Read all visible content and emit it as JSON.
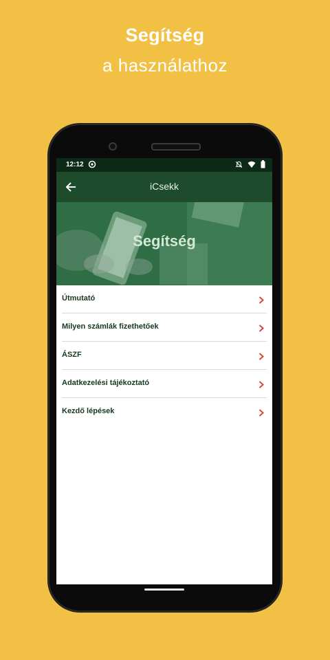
{
  "promo": {
    "title": "Segítség",
    "subtitle": "a használathoz"
  },
  "status_bar": {
    "time": "12:12",
    "icons": [
      "app-notification-icon",
      "silent-icon",
      "wifi-icon",
      "battery-icon"
    ]
  },
  "app_bar": {
    "title": "iCsekk",
    "back_icon": "arrow-left-icon"
  },
  "hero": {
    "title": "Segítség"
  },
  "menu": {
    "items": [
      {
        "label": "Útmutató"
      },
      {
        "label": "Milyen számlák fizethetőek"
      },
      {
        "label": "ÁSZF"
      },
      {
        "label": "Adatkezelési tájékoztató"
      },
      {
        "label": "Kezdő lépések"
      }
    ]
  },
  "colors": {
    "background": "#f2c045",
    "app_bar": "#1d4b2c",
    "status_bar": "#0d2a16",
    "menu_text": "#17381f",
    "chevron": "#d9473b"
  }
}
